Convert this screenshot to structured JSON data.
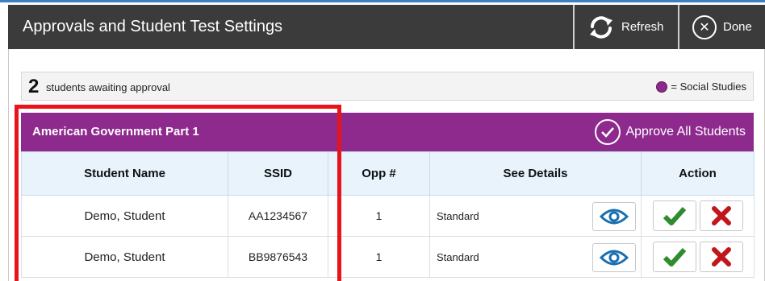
{
  "window": {
    "title": "Approvals and Student Test Settings",
    "refresh_label": "Refresh",
    "done_label": "Done"
  },
  "summary": {
    "count": "2",
    "text": "students awaiting approval",
    "legend_text": "= Social Studies",
    "legend_color": "#8c2a8c"
  },
  "group": {
    "title": "American Government Part 1",
    "approve_all_label": "Approve All Students",
    "color": "#8e2a8e"
  },
  "table": {
    "headers": {
      "student_name": "Student Name",
      "ssid": "SSID",
      "opp": "Opp #",
      "see_details": "See Details",
      "action": "Action"
    },
    "rows": [
      {
        "name": "Demo, Student",
        "ssid": "AA1234567",
        "opp": "1",
        "details": "Standard"
      },
      {
        "name": "Demo, Student",
        "ssid": "BB9876543",
        "opp": "1",
        "details": "Standard"
      }
    ]
  },
  "icons": {
    "refresh": "refresh-icon",
    "done": "close-circle-icon",
    "approve_all": "check-circle-icon",
    "view": "eye-icon",
    "approve": "checkmark-icon",
    "deny": "x-icon"
  },
  "colors": {
    "approve": "#2e8b2e",
    "deny": "#c0161c",
    "eye": "#1a6fb0",
    "highlight": "#e8141c"
  }
}
